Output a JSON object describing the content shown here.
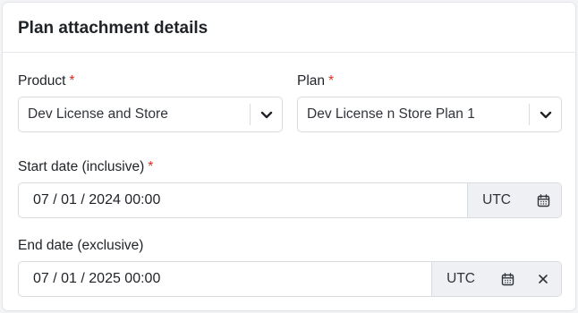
{
  "card": {
    "title": "Plan attachment details"
  },
  "required_mark": "*",
  "product": {
    "label": "Product",
    "value": "Dev License and Store"
  },
  "plan": {
    "label": "Plan",
    "value": "Dev License n Store Plan 1"
  },
  "start_date": {
    "label": "Start date (inclusive)",
    "value": "07 / 01 / 2024 00:00",
    "timezone": "UTC"
  },
  "end_date": {
    "label": "End date (exclusive)",
    "value": "07 / 01 / 2025 00:00",
    "timezone": "UTC"
  },
  "icons": {
    "select_toggle": "chevron-down-icon",
    "calendar": "calendar-icon",
    "clear": "close-icon"
  },
  "colors": {
    "required": "#d93025",
    "addon_bg": "#eef0f3",
    "border": "#d8dbe0"
  }
}
